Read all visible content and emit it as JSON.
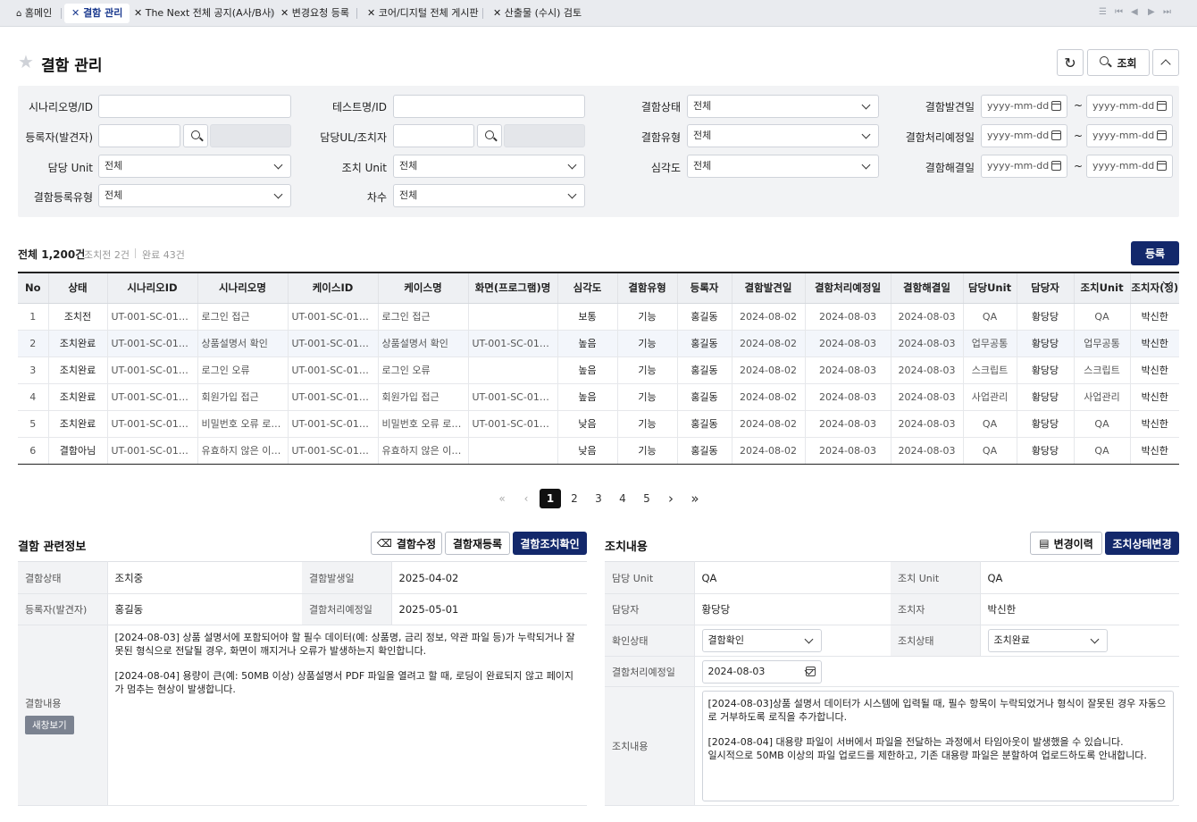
{
  "tabs": [
    {
      "label": "홈메인",
      "icon": "home-icon"
    },
    {
      "label": "결함 관리",
      "icon": "close-icon",
      "active": true
    },
    {
      "label": "The Next 전체 공지(A사/B사)",
      "icon": "close-icon"
    },
    {
      "label": "변경요청 등록",
      "icon": "close-icon"
    },
    {
      "label": "코어/디지털 전체 게시판",
      "icon": "close-icon"
    },
    {
      "label": "산출물 (수시) 검토",
      "icon": "close-icon"
    }
  ],
  "page": {
    "title": "결함 관리",
    "search_label": "조회"
  },
  "filter": {
    "scenario_label": "시나리오명/ID",
    "test_label": "테스트명/ID",
    "defect_status_label": "결함상태",
    "defect_status_value": "전체",
    "found_date_label": "결함발견일",
    "registrant_label": "등록자(발견자)",
    "owner_label": "담당UL/조치자",
    "defect_type_label": "결함유형",
    "defect_type_value": "전체",
    "planned_date_label": "결함처리예정일",
    "unit_label": "담당 Unit",
    "unit_value": "전체",
    "action_unit_label": "조치 Unit",
    "action_unit_value": "전체",
    "severity_label": "심각도",
    "severity_value": "전체",
    "resolved_date_label": "결함해결일",
    "reg_type_label": "결함등록유형",
    "reg_type_value": "전체",
    "round_label": "차수",
    "round_value": "전체",
    "date_placeholder": "yyyy-mm-dd",
    "tilde": "~"
  },
  "summary": {
    "total": "전체 1,200건",
    "pending": "조치전 2건",
    "done": "완료 43건",
    "register_label": "등록"
  },
  "table": {
    "headers": [
      "No",
      "상태",
      "시나리오ID",
      "시나리오명",
      "케이스ID",
      "케이스명",
      "화면(프로그램)명",
      "심각도",
      "결함유형",
      "등록자",
      "결함발견일",
      "결함처리예정일",
      "결함해결일",
      "담당Unit",
      "담당자",
      "조치Unit",
      "조치자(정)"
    ],
    "rows": [
      [
        "1",
        "조치전",
        "UT-001-SC-01A0...",
        "로그인 접근",
        "UT-001-SC-01A0...",
        "로그인 접근",
        "",
        "보통",
        "기능",
        "홍길동",
        "2024-08-02",
        "2024-08-03",
        "2024-08-03",
        "QA",
        "황당당",
        "QA",
        "박신한"
      ],
      [
        "2",
        "조치완료",
        "UT-001-SC-01A0...",
        "상품설명서 확인",
        "UT-001-SC-01A0...",
        "상품설명서 확인",
        "UT-001-SC-01A0...",
        "높음",
        "기능",
        "홍길동",
        "2024-08-02",
        "2024-08-03",
        "2024-08-03",
        "업무공통",
        "황당당",
        "업무공통",
        "박신한"
      ],
      [
        "3",
        "조치완료",
        "UT-001-SC-01A0...",
        "로그인 오류",
        "UT-001-SC-01A0...",
        "로그인 오류",
        "",
        "높음",
        "기능",
        "홍길동",
        "2024-08-02",
        "2024-08-03",
        "2024-08-03",
        "스크립트",
        "황당당",
        "스크립트",
        "박신한"
      ],
      [
        "4",
        "조치완료",
        "UT-001-SC-01A0...",
        "회원가입 접근",
        "UT-001-SC-01A0...",
        "회원가입 접근",
        "UT-001-SC-01A0...",
        "높음",
        "기능",
        "홍길동",
        "2024-08-02",
        "2024-08-03",
        "2024-08-03",
        "사업관리",
        "황당당",
        "사업관리",
        "박신한"
      ],
      [
        "5",
        "조치완료",
        "UT-001-SC-01A0...",
        "비밀번호 오류 로그인",
        "UT-001-SC-01A0...",
        "비밀번호 오류 로그인",
        "UT-001-SC-01A0...",
        "낮음",
        "기능",
        "홍길동",
        "2024-08-02",
        "2024-08-03",
        "2024-08-03",
        "QA",
        "황당당",
        "QA",
        "박신한"
      ],
      [
        "6",
        "결함아님",
        "UT-001-SC-01A0...",
        "유효하지 않은 이메일",
        "UT-001-SC-01A0...",
        "유효하지 않은 이메일",
        "",
        "낮음",
        "기능",
        "홍길동",
        "2024-08-02",
        "2024-08-03",
        "2024-08-03",
        "QA",
        "황당당",
        "QA",
        "박신한"
      ]
    ]
  },
  "pager": {
    "pages": [
      "1",
      "2",
      "3",
      "4",
      "5"
    ],
    "current": "1"
  },
  "defect_info": {
    "title": "결함 관련정보",
    "edit_label": "결함수정",
    "reregister_label": "결함재등록",
    "confirm_label": "결함조치확인",
    "status_label": "결함상태",
    "status_value": "조치중",
    "occurred_label": "결함발생일",
    "occurred_value": "2025-04-02",
    "registrant_label": "등록자(발견자)",
    "registrant_value": "홍길동",
    "planned_label": "결함처리예정일",
    "planned_value": "2025-05-01",
    "content_label": "결함내용",
    "popup_label": "새창보기",
    "content_1": "[2024-08-03] 상품 설명서에 포함되어야 할 필수 데이터(예: 상품명, 금리 정보, 약관 파일 등)가 누락되거나 잘못된 형식으로 전달될 경우, 화면이 깨지거나 오류가 발생하는지 확인합니다.",
    "content_2": "[2024-08-04] 용량이 큰(예: 50MB 이상) 상품설명서 PDF 파일을 열려고 할 때, 로딩이 완료되지 않고 페이지가 멈추는 현상이 발생합니다."
  },
  "action_info": {
    "title": "조치내용",
    "history_label": "변경이력",
    "change_label": "조치상태변경",
    "unit_label": "담당 Unit",
    "unit_value": "QA",
    "action_unit_label": "조치 Unit",
    "action_unit_value": "QA",
    "owner_label": "담당자",
    "owner_value": "황당당",
    "actor_label": "조치자",
    "actor_value": "박신한",
    "confirm_label": "확인상태",
    "confirm_value": "결함확인",
    "action_status_label": "조치상태",
    "action_status_value": "조치완료",
    "planned_label": "결함처리예정일",
    "planned_value": "2024-08-03",
    "content_label": "조치내용",
    "content_1": "[2024-08-03]상품 설명서 데이터가 시스템에 입력될 때, 필수 항목이 누락되었거나 형식이 잘못된 경우 자동으로 거부하도록 로직을 추가합니다.",
    "content_2": "[2024-08-04] 대용량 파일이 서버에서 파일을 전달하는 과정에서 타임아웃이 발생했을 수 있습니다.",
    "content_3": "일시적으로 50MB 이상의 파일 업로드를 제한하고, 기존 대용량 파일은 분할하여 업로드하도록 안내합니다."
  },
  "colors": {
    "navy": "#13286b",
    "active_tab": "#1b3a8f"
  }
}
